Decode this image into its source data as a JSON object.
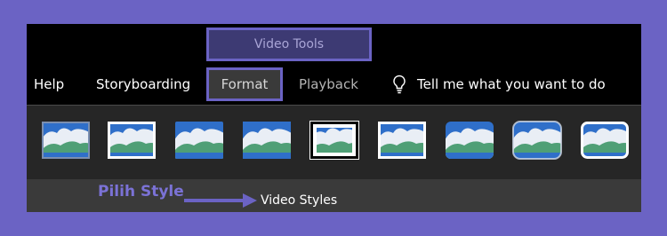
{
  "ribbon": {
    "context_group": "Video Tools",
    "tabs": [
      {
        "label": "Help"
      },
      {
        "label": "Storyboarding"
      },
      {
        "label": "Format",
        "active": true
      },
      {
        "label": "Playback"
      }
    ],
    "tell_me": "Tell me what you want to do"
  },
  "gallery": {
    "group_label": "Video Styles",
    "style_count": 9
  },
  "annotation": {
    "callout": "Pilih Style"
  },
  "colors": {
    "highlight": "#6b63c4",
    "callout_text": "#7b72d6",
    "sky": "#2f6fc9",
    "cloud": "#e9eef5",
    "hill": "#4f9f76"
  }
}
